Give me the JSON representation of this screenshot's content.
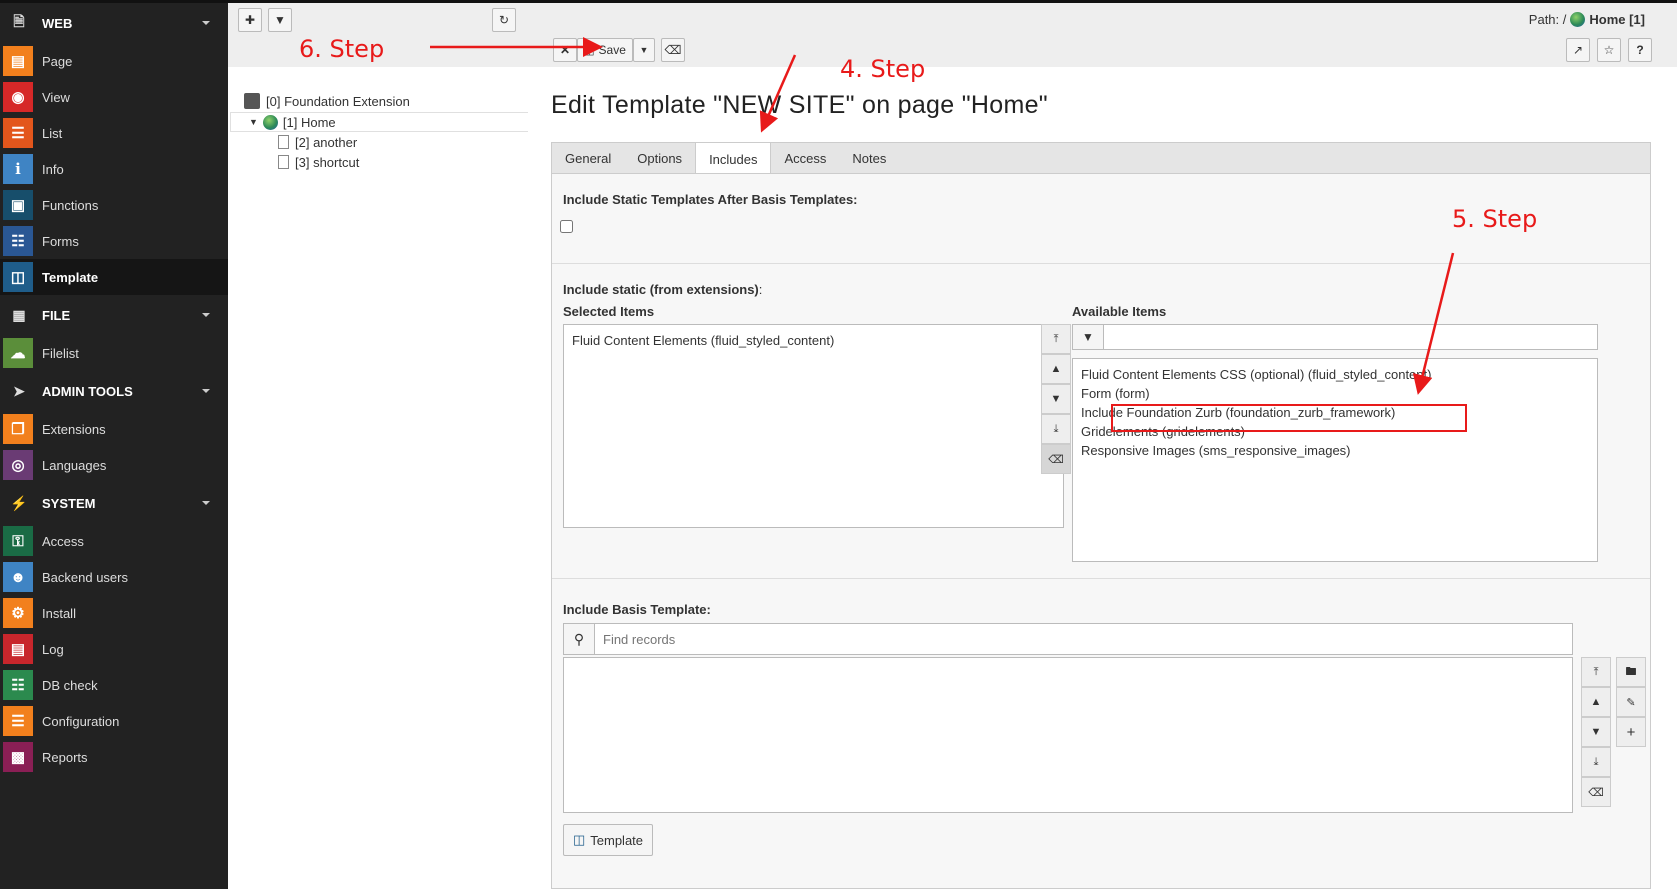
{
  "sidebar": {
    "sections": [
      {
        "label": "WEB",
        "icon": "file-icon",
        "modules": [
          {
            "label": "Page",
            "icon": "page-icon",
            "color": "#f2801d"
          },
          {
            "label": "View",
            "icon": "eye-icon",
            "color": "#d62828"
          },
          {
            "label": "List",
            "icon": "list-icon",
            "color": "#e3561c"
          },
          {
            "label": "Info",
            "icon": "info-icon",
            "color": "#3f84c4"
          },
          {
            "label": "Functions",
            "icon": "briefcase-icon",
            "color": "#174e6b"
          },
          {
            "label": "Forms",
            "icon": "forms-icon",
            "color": "#2a5794"
          },
          {
            "label": "Template",
            "icon": "template-icon",
            "color": "#1f5d8a"
          }
        ]
      },
      {
        "label": "FILE",
        "icon": "image-icon",
        "modules": [
          {
            "label": "Filelist",
            "icon": "cloud-icon",
            "color": "#5b8e3a"
          }
        ]
      },
      {
        "label": "ADMIN TOOLS",
        "icon": "rocket-icon",
        "modules": [
          {
            "label": "Extensions",
            "icon": "box-icon",
            "color": "#f2801d"
          },
          {
            "label": "Languages",
            "icon": "globe-icon",
            "color": "#6a3b74"
          }
        ]
      },
      {
        "label": "SYSTEM",
        "icon": "plug-icon",
        "modules": [
          {
            "label": "Access",
            "icon": "lock-icon",
            "color": "#1a6b45"
          },
          {
            "label": "Backend users",
            "icon": "user-icon",
            "color": "#3f84c4"
          },
          {
            "label": "Install",
            "icon": "install-icon",
            "color": "#f2801d"
          },
          {
            "label": "Log",
            "icon": "log-icon",
            "color": "#c8262c"
          },
          {
            "label": "DB check",
            "icon": "database-icon",
            "color": "#2b8a4e"
          },
          {
            "label": "Configuration",
            "icon": "sliders-icon",
            "color": "#f2801d"
          },
          {
            "label": "Reports",
            "icon": "reports-icon",
            "color": "#8a1f55"
          }
        ]
      }
    ]
  },
  "docheader": {
    "save_label": "Save",
    "path_label": "Path: /",
    "path_page": "Home [1]"
  },
  "tree": {
    "root": "[0] Foundation Extension",
    "home": "[1] Home",
    "child1": "[2] another",
    "child2": "[3] shortcut"
  },
  "content": {
    "title": "Edit Template \"NEW SITE\" on page \"Home\"",
    "tabs": [
      "General",
      "Options",
      "Includes",
      "Access",
      "Notes"
    ],
    "active_tab": "Includes",
    "static_after_label": "Include Static Templates After Basis Templates:",
    "include_static_label": "Include static (from extensions)",
    "include_static_colon": ":",
    "selected_label": "Selected Items",
    "available_label": "Available Items",
    "selected_items": [
      "Fluid Content Elements (fluid_styled_content)"
    ],
    "available_items": [
      "Fluid Content Elements CSS (optional) (fluid_styled_content)",
      "Form (form)",
      "Include Foundation Zurb (foundation_zurb_framework)",
      "Gridelements (gridelements)",
      "Responsive Images (sms_responsive_images)"
    ],
    "basis_label": "Include Basis Template:",
    "find_placeholder": "Find records",
    "template_button": "Template"
  },
  "annotations": {
    "step4": "4. Step",
    "step5": "5. Step",
    "step6": "6. Step",
    "color": "#e81a1a"
  }
}
